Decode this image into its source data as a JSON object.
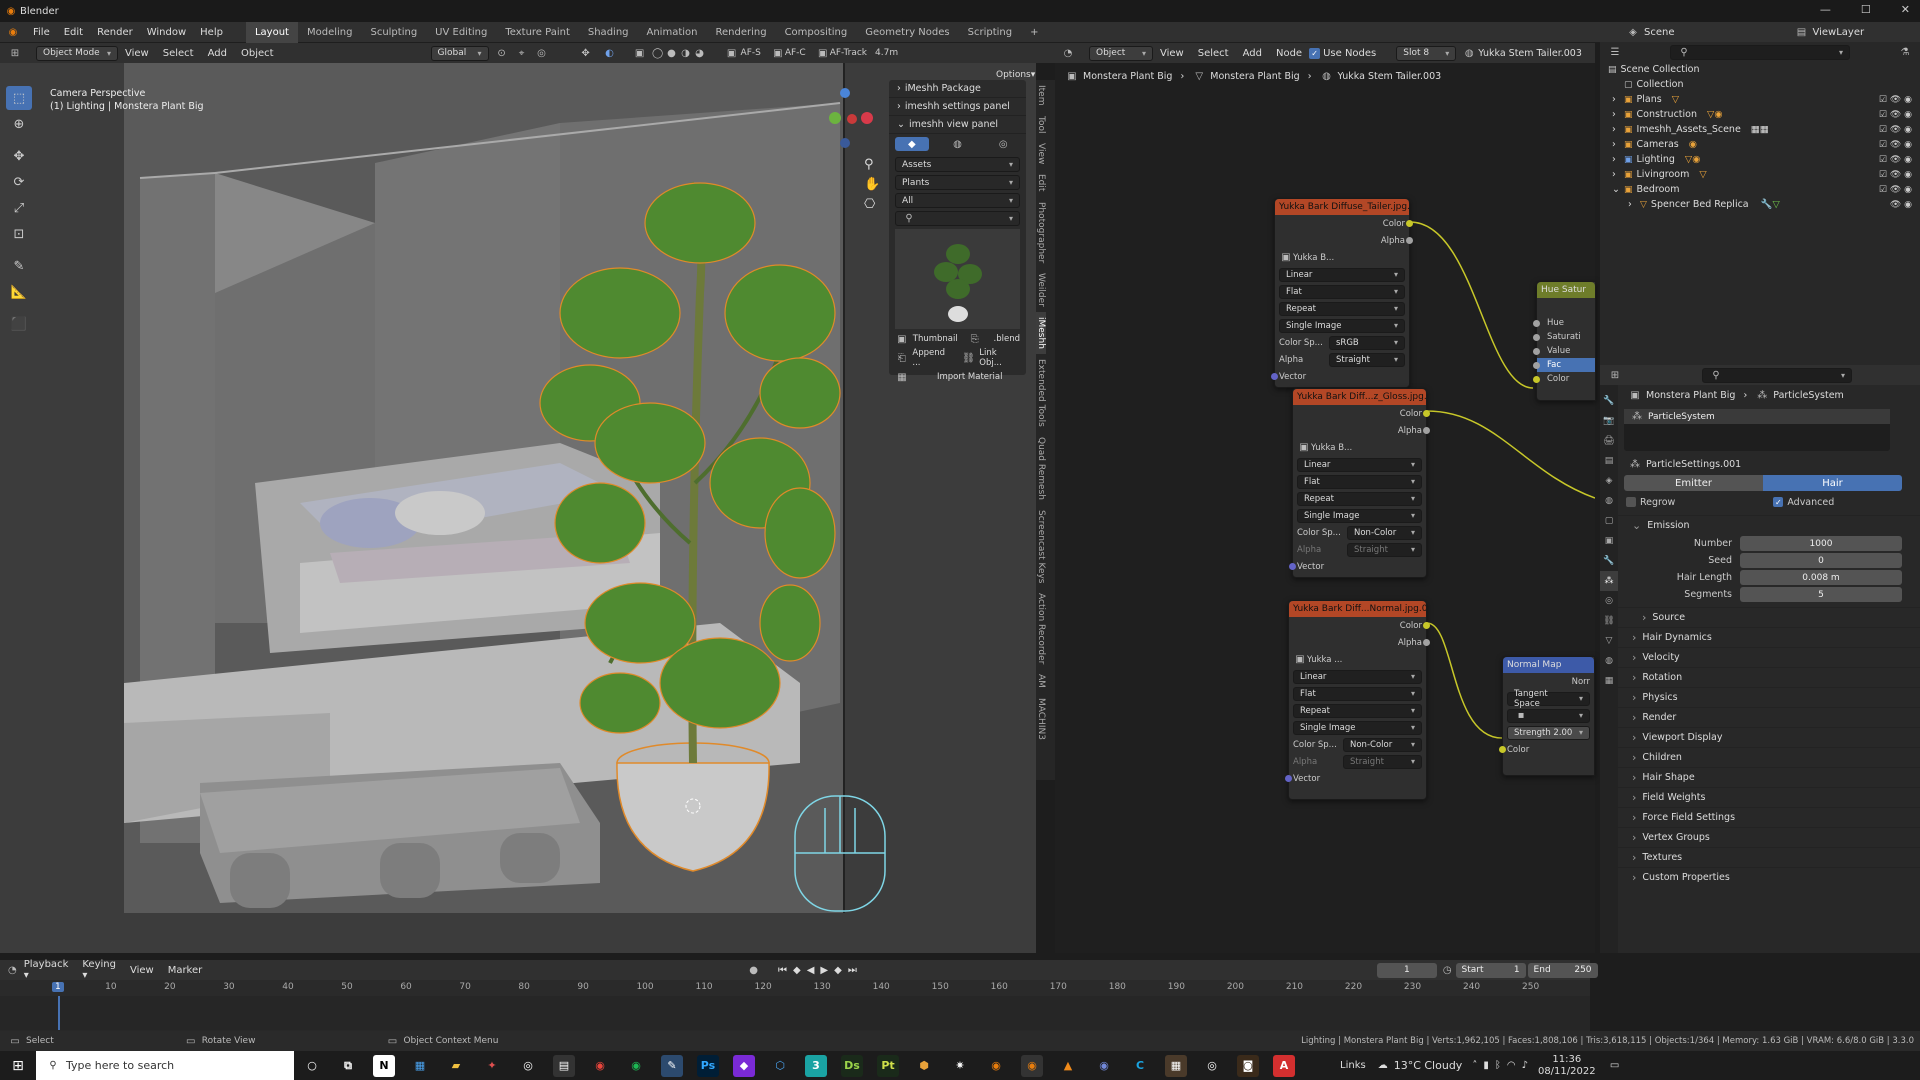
{
  "titlebar": {
    "title": "Blender"
  },
  "menu": {
    "items": [
      "File",
      "Edit",
      "Render",
      "Window",
      "Help"
    ]
  },
  "workspaces": [
    "Layout",
    "Modeling",
    "Sculpting",
    "UV Editing",
    "Texture Paint",
    "Shading",
    "Animation",
    "Rendering",
    "Compositing",
    "Geometry Nodes",
    "Scripting"
  ],
  "viewport_header": {
    "mode": "Object Mode",
    "menus": [
      "View",
      "Select",
      "Add",
      "Object"
    ],
    "orientation": "Global",
    "af_s": "AF-S",
    "af_c": "AF-C",
    "af_track": "AF-Track",
    "focal": "4.7m"
  },
  "viewport": {
    "overlay_line1": "Camera Perspective",
    "overlay_line2": "(1) Lighting | Monstera Plant Big",
    "options": "Options"
  },
  "npanel": {
    "items": [
      "iMeshh Package",
      "imeshh settings panel",
      "imeshh view panel"
    ],
    "selects": [
      "Assets",
      "Plants",
      "All"
    ],
    "thumb_btn": "Thumbnail",
    "blend_btn": ".blend",
    "append_btn": "Append ...",
    "link_btn": "Link Obj...",
    "import_btn": "Import Material"
  },
  "vtabs": [
    "Item",
    "Tool",
    "View",
    "Edit",
    "Photographer",
    "Weilder",
    "iMeshh",
    "Extended Tools",
    "Quad Remesh",
    "Screencast Keys",
    "Action Recorder",
    "AM",
    "MACHIN3"
  ],
  "node_header": {
    "object": "Object",
    "menus": [
      "View",
      "Select",
      "Add",
      "Node"
    ],
    "use_nodes": "Use Nodes",
    "slot": "Slot 8",
    "material": "Yukka Stem Tailer.003"
  },
  "breadcrumb": [
    "Monstera Plant Big",
    "Monstera Plant Big",
    "Yukka Stem Tailer.003"
  ],
  "nodes": [
    {
      "title": "Yukka Bark Diffuse_Tailer.jpg.0...",
      "img": "Yukka B...",
      "opts": [
        "Linear",
        "Flat",
        "Repeat",
        "Single Image"
      ],
      "colorspace_label": "Color Sp...",
      "colorspace": "sRGB",
      "alpha_label": "Alpha",
      "alpha": "Straight",
      "out_color": "Color",
      "out_alpha": "Alpha",
      "in_vector": "Vector"
    },
    {
      "title": "Yukka Bark Diff...z_Gloss.jpg.003",
      "img": "Yukka B...",
      "opts": [
        "Linear",
        "Flat",
        "Repeat",
        "Single Image"
      ],
      "colorspace_label": "Color Sp...",
      "colorspace": "Non-Color",
      "alpha_label": "Alpha",
      "alpha": "Straight",
      "out_color": "Color",
      "out_alpha": "Alpha",
      "in_vector": "Vector"
    },
    {
      "title": "Yukka Bark Diff...Normal.jpg.003",
      "img": "Yukka ...",
      "opts": [
        "Linear",
        "Flat",
        "Repeat",
        "Single Image"
      ],
      "colorspace_label": "Color Sp...",
      "colorspace": "Non-Color",
      "alpha_label": "Alpha",
      "alpha": "Straight",
      "out_color": "Color",
      "out_alpha": "Alpha",
      "in_vector": "Vector"
    }
  ],
  "hue_node": {
    "title": "Hue Satur",
    "rows": [
      "Hue",
      "Saturati",
      "Value",
      "Fac",
      "Color"
    ]
  },
  "normal_node": {
    "title": "Normal Map",
    "out": "Norr",
    "space": "Tangent Space",
    "strength_label": "Strength",
    "strength": "2.00",
    "in_color": "Color"
  },
  "outliner_header": {
    "scene": "Scene",
    "viewlayer": "ViewLayer"
  },
  "outliner": {
    "root": "Scene Collection",
    "items": [
      "Collection",
      "Plans",
      "Construction",
      "Imeshh_Assets_Scene",
      "Cameras",
      "Lighting",
      "Livingroom",
      "Bedroom"
    ],
    "child": "Spencer Bed Replica"
  },
  "props": {
    "breadcrumb": [
      "Monstera Plant Big",
      "ParticleSystem"
    ],
    "system": "ParticleSystem",
    "settings": "ParticleSettings.001",
    "type_emitter": "Emitter",
    "type_hair": "Hair",
    "regrow": "Regrow",
    "advanced": "Advanced",
    "emission": "Emission",
    "fields": [
      {
        "label": "Number",
        "value": "1000"
      },
      {
        "label": "Seed",
        "value": "0"
      },
      {
        "label": "Hair Length",
        "value": "0.008 m"
      },
      {
        "label": "Segments",
        "value": "5"
      }
    ],
    "source": "Source",
    "sections": [
      "Hair Dynamics",
      "Velocity",
      "Rotation",
      "Physics",
      "Render",
      "Viewport Display",
      "Children",
      "Hair Shape",
      "Field Weights",
      "Force Field Settings",
      "Vertex Groups",
      "Textures",
      "Custom Properties"
    ]
  },
  "timeline": {
    "menus": [
      "Playback",
      "Keying",
      "View",
      "Marker"
    ],
    "current": "1",
    "start_label": "Start",
    "start": "1",
    "end_label": "End",
    "end": "250",
    "ticks": [
      "1",
      "10",
      "20",
      "30",
      "40",
      "50",
      "60",
      "70",
      "80",
      "90",
      "100",
      "110",
      "120",
      "130",
      "140",
      "150",
      "160",
      "170",
      "180",
      "190",
      "200",
      "210",
      "220",
      "230",
      "240",
      "250"
    ]
  },
  "status": {
    "select": "Select",
    "rotate": "Rotate View",
    "context": "Object Context Menu",
    "info": "Lighting | Monstera Plant Big | Verts:1,962,105 | Faces:1,808,106 | Tris:3,618,115 | Objects:1/364 | Memory: 1.63 GiB | VRAM: 6.6/8.0 GiB | 3.3.0"
  },
  "taskbar": {
    "search": "Type here to search",
    "links": "Links",
    "weather": "13°C  Cloudy",
    "time": "11:36",
    "date": "08/11/2022"
  }
}
